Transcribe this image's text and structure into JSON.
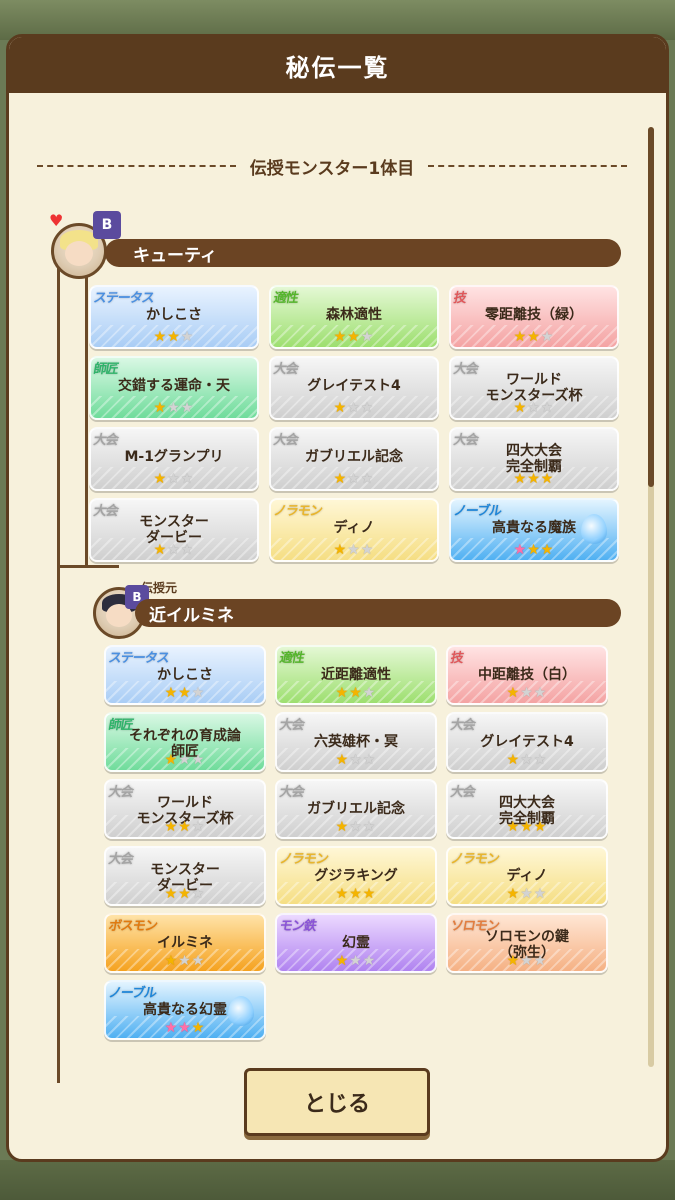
{
  "dialog": {
    "title": "秘伝一覧",
    "close_label": "とじる"
  },
  "section": {
    "header": "伝授モンスター1体目"
  },
  "monster1": {
    "name": "キューティ",
    "grade": "B",
    "cards": [
      {
        "tag": "ステータス",
        "title": "かしこさ",
        "stars": [
          "gold",
          "gold",
          "grey"
        ],
        "style": "blue"
      },
      {
        "tag": "適性",
        "title": "森林適性",
        "stars": [
          "gold",
          "gold",
          "grey"
        ],
        "style": "green"
      },
      {
        "tag": "技",
        "title": "零距離技（緑）",
        "stars": [
          "gold",
          "gold",
          "grey"
        ],
        "style": "red"
      },
      {
        "tag": "師匠",
        "title": "交錯する運命・天",
        "stars": [
          "gold",
          "grey",
          "grey"
        ],
        "style": "mint"
      },
      {
        "tag": "大会",
        "title": "グレイテスト4",
        "stars": [
          "gold",
          "grey",
          "grey"
        ],
        "style": "grey"
      },
      {
        "tag": "大会",
        "title": "ワールド\nモンスターズ杯",
        "stars": [
          "gold",
          "grey",
          "grey"
        ],
        "style": "grey"
      },
      {
        "tag": "大会",
        "title": "M-1グランプリ",
        "stars": [
          "gold",
          "grey",
          "grey"
        ],
        "style": "grey"
      },
      {
        "tag": "大会",
        "title": "ガブリエル記念",
        "stars": [
          "gold",
          "grey",
          "grey"
        ],
        "style": "grey"
      },
      {
        "tag": "大会",
        "title": "四大大会\n完全制覇",
        "stars": [
          "gold",
          "gold",
          "gold"
        ],
        "style": "grey"
      },
      {
        "tag": "大会",
        "title": "モンスター\nダービー",
        "stars": [
          "gold",
          "grey",
          "grey"
        ],
        "style": "grey"
      },
      {
        "tag": "ノラモン",
        "title": "ディノ",
        "stars": [
          "gold",
          "grey",
          "grey"
        ],
        "style": "yellow"
      },
      {
        "tag": "ノーブル",
        "title": "高貴なる魔族",
        "stars": [
          "pink",
          "gold",
          "gold"
        ],
        "style": "noble"
      }
    ]
  },
  "monster2": {
    "source_label": "伝授元",
    "name": "近イルミネ",
    "grade": "B",
    "cards": [
      {
        "tag": "ステータス",
        "title": "かしこさ",
        "stars": [
          "gold",
          "gold",
          "grey"
        ],
        "style": "blue"
      },
      {
        "tag": "適性",
        "title": "近距離適性",
        "stars": [
          "gold",
          "gold",
          "grey"
        ],
        "style": "green"
      },
      {
        "tag": "技",
        "title": "中距離技（白）",
        "stars": [
          "gold",
          "grey",
          "grey"
        ],
        "style": "red"
      },
      {
        "tag": "師匠",
        "title": "それぞれの育成論\n師匠",
        "stars": [
          "gold",
          "grey",
          "grey"
        ],
        "style": "mint"
      },
      {
        "tag": "大会",
        "title": "六英雄杯・冥",
        "stars": [
          "gold",
          "grey",
          "grey"
        ],
        "style": "grey"
      },
      {
        "tag": "大会",
        "title": "グレイテスト4",
        "stars": [
          "gold",
          "grey",
          "grey"
        ],
        "style": "grey"
      },
      {
        "tag": "大会",
        "title": "ワールド\nモンスターズ杯",
        "stars": [
          "gold",
          "gold",
          "grey"
        ],
        "style": "grey"
      },
      {
        "tag": "大会",
        "title": "ガブリエル記念",
        "stars": [
          "gold",
          "grey",
          "grey"
        ],
        "style": "grey"
      },
      {
        "tag": "大会",
        "title": "四大大会\n完全制覇",
        "stars": [
          "gold",
          "gold",
          "gold"
        ],
        "style": "grey"
      },
      {
        "tag": "大会",
        "title": "モンスター\nダービー",
        "stars": [
          "gold",
          "gold",
          "grey"
        ],
        "style": "grey"
      },
      {
        "tag": "ノラモン",
        "title": "グジラキング",
        "stars": [
          "gold",
          "gold",
          "gold"
        ],
        "style": "yellow"
      },
      {
        "tag": "ノラモン",
        "title": "ディノ",
        "stars": [
          "gold",
          "grey",
          "grey"
        ],
        "style": "yellow"
      },
      {
        "tag": "ボスモン",
        "title": "イルミネ",
        "stars": [
          "gold",
          "grey",
          "grey"
        ],
        "style": "orange"
      },
      {
        "tag": "モン鉄",
        "title": "幻霊",
        "stars": [
          "gold",
          "grey",
          "grey"
        ],
        "style": "purple"
      },
      {
        "tag": "ソロモン",
        "title": "ソロモンの鍵\n（弥生）",
        "stars": [
          "gold",
          "grey",
          "grey"
        ],
        "style": "salmon"
      },
      {
        "tag": "ノーブル",
        "title": "高貴なる幻霊",
        "stars": [
          "pink",
          "pink",
          "gold"
        ],
        "style": "noble"
      }
    ]
  },
  "styles": {
    "blue": {
      "bg": "linear-gradient(#e9f3ff,#a9cdf5)",
      "tag": "#4a8fe0"
    },
    "green": {
      "bg": "linear-gradient(#e4f8d4,#9ddf6f)",
      "tag": "#55b52c"
    },
    "red": {
      "bg": "linear-gradient(#ffe3e3,#f4a3a3)",
      "tag": "#e0575a"
    },
    "mint": {
      "bg": "linear-gradient(#d9f8e4,#6fdc9b)",
      "tag": "#2fb36a"
    },
    "grey": {
      "bg": "linear-gradient(#f6f6f6,#cfcfcf)",
      "tag": "#a4a4a4"
    },
    "yellow": {
      "bg": "linear-gradient(#fff7d6,#f5de83)",
      "tag": "#e8b52d"
    },
    "noble": {
      "bg": "linear-gradient(#e3f4ff,#4fb0f2)",
      "tag": "#1f86d8"
    },
    "orange": {
      "bg": "linear-gradient(#ffe3a8,#f5a21f)",
      "tag": "#e07a10"
    },
    "purple": {
      "bg": "linear-gradient(#ecd9ff,#b083f0)",
      "tag": "#8a54d6"
    },
    "salmon": {
      "bg": "linear-gradient(#ffe6d4,#f5b184)",
      "tag": "#e27d3f"
    }
  }
}
